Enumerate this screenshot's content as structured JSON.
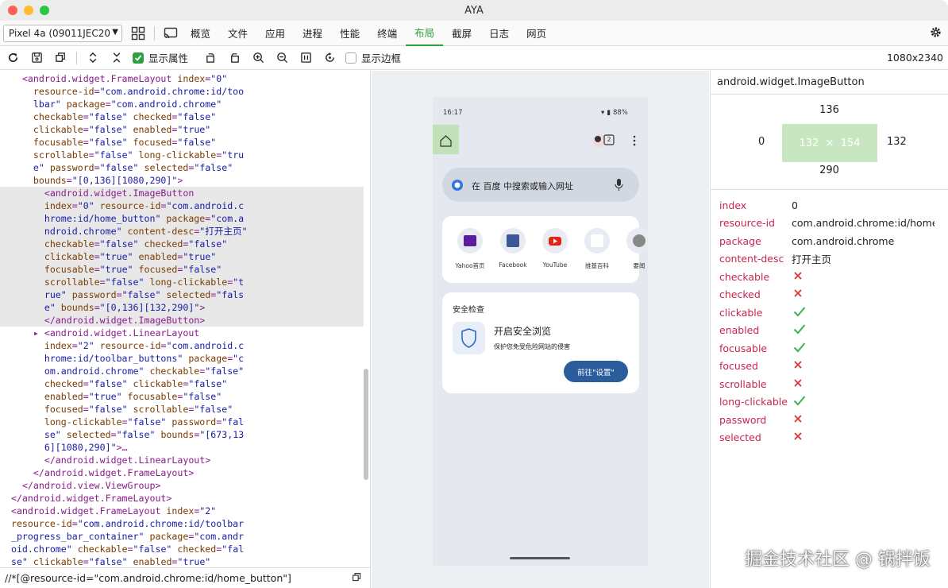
{
  "window": {
    "title": "AYA"
  },
  "toolbar": {
    "device": "Pixel 4a (09011JEC204",
    "tabs": [
      "概览",
      "文件",
      "应用",
      "进程",
      "性能",
      "终端",
      "布局",
      "截屏",
      "日志",
      "网页"
    ],
    "active_tab": "布局"
  },
  "toolbar2": {
    "show_attrs_label": "显示属性",
    "show_border_label": "显示边框",
    "resolution": "1080x2340"
  },
  "xml_tree": [
    [
      [
        "tag",
        "    <android.widget.FrameLayout "
      ],
      [
        "attr",
        "index"
      ],
      [
        "tag",
        "="
      ],
      [
        "val",
        "\"0\""
      ]
    ],
    [
      [
        "attr",
        "      resource-id"
      ],
      [
        "tag",
        "="
      ],
      [
        "val",
        "\"com.android.chrome:id/too"
      ]
    ],
    [
      [
        "val",
        "      lbar\""
      ],
      [
        "attr",
        " package"
      ],
      [
        "tag",
        "="
      ],
      [
        "val",
        "\"com.android.chrome\""
      ]
    ],
    [
      [
        "attr",
        "      checkable"
      ],
      [
        "tag",
        "="
      ],
      [
        "val",
        "\"false\""
      ],
      [
        "attr",
        " checked"
      ],
      [
        "tag",
        "="
      ],
      [
        "val",
        "\"false\""
      ]
    ],
    [
      [
        "attr",
        "      clickable"
      ],
      [
        "tag",
        "="
      ],
      [
        "val",
        "\"false\""
      ],
      [
        "attr",
        " enabled"
      ],
      [
        "tag",
        "="
      ],
      [
        "val",
        "\"true\""
      ]
    ],
    [
      [
        "attr",
        "      focusable"
      ],
      [
        "tag",
        "="
      ],
      [
        "val",
        "\"false\""
      ],
      [
        "attr",
        " focused"
      ],
      [
        "tag",
        "="
      ],
      [
        "val",
        "\"false\""
      ]
    ],
    [
      [
        "attr",
        "      scrollable"
      ],
      [
        "tag",
        "="
      ],
      [
        "val",
        "\"false\""
      ],
      [
        "attr",
        " long-clickable"
      ],
      [
        "tag",
        "="
      ],
      [
        "val",
        "\"tru"
      ]
    ],
    [
      [
        "val",
        "      e\""
      ],
      [
        "attr",
        " password"
      ],
      [
        "tag",
        "="
      ],
      [
        "val",
        "\"false\""
      ],
      [
        "attr",
        " selected"
      ],
      [
        "tag",
        "="
      ],
      [
        "val",
        "\"false\""
      ]
    ],
    [
      [
        "attr",
        "      bounds"
      ],
      [
        "tag",
        "="
      ],
      [
        "val",
        "\"[0,136][1080,290]\""
      ],
      [
        "tag",
        ">"
      ]
    ],
    [
      [
        "tag",
        "        <android.widget.ImageButton"
      ]
    ],
    [
      [
        "attr",
        "        index"
      ],
      [
        "tag",
        "="
      ],
      [
        "val",
        "\"0\""
      ],
      [
        "attr",
        " resource-id"
      ],
      [
        "tag",
        "="
      ],
      [
        "val",
        "\"com.android.c"
      ]
    ],
    [
      [
        "val",
        "        hrome:id/home_button\""
      ],
      [
        "attr",
        " package"
      ],
      [
        "tag",
        "="
      ],
      [
        "val",
        "\"com.a"
      ]
    ],
    [
      [
        "val",
        "        ndroid.chrome\""
      ],
      [
        "attr",
        " content-desc"
      ],
      [
        "tag",
        "="
      ],
      [
        "val",
        "\"打开主页\""
      ]
    ],
    [
      [
        "attr",
        "        checkable"
      ],
      [
        "tag",
        "="
      ],
      [
        "val",
        "\"false\""
      ],
      [
        "attr",
        " checked"
      ],
      [
        "tag",
        "="
      ],
      [
        "val",
        "\"false\""
      ]
    ],
    [
      [
        "attr",
        "        clickable"
      ],
      [
        "tag",
        "="
      ],
      [
        "val",
        "\"true\""
      ],
      [
        "attr",
        " enabled"
      ],
      [
        "tag",
        "="
      ],
      [
        "val",
        "\"true\""
      ]
    ],
    [
      [
        "attr",
        "        focusable"
      ],
      [
        "tag",
        "="
      ],
      [
        "val",
        "\"true\""
      ],
      [
        "attr",
        " focused"
      ],
      [
        "tag",
        "="
      ],
      [
        "val",
        "\"false\""
      ]
    ],
    [
      [
        "attr",
        "        scrollable"
      ],
      [
        "tag",
        "="
      ],
      [
        "val",
        "\"false\""
      ],
      [
        "attr",
        " long-clickable"
      ],
      [
        "tag",
        "="
      ],
      [
        "val",
        "\"t"
      ]
    ],
    [
      [
        "val",
        "        rue\""
      ],
      [
        "attr",
        " password"
      ],
      [
        "tag",
        "="
      ],
      [
        "val",
        "\"false\""
      ],
      [
        "attr",
        " selected"
      ],
      [
        "tag",
        "="
      ],
      [
        "val",
        "\"fals"
      ]
    ],
    [
      [
        "val",
        "        e\""
      ],
      [
        "attr",
        " bounds"
      ],
      [
        "tag",
        "="
      ],
      [
        "val",
        "\"[0,136][132,290]\""
      ],
      [
        "tag",
        ">"
      ]
    ],
    [
      [
        "tag",
        "        </android.widget.ImageButton>"
      ]
    ],
    [
      [
        "tag",
        "      ▸ <android.widget.LinearLayout"
      ]
    ],
    [
      [
        "attr",
        "        index"
      ],
      [
        "tag",
        "="
      ],
      [
        "val",
        "\"2\""
      ],
      [
        "attr",
        " resource-id"
      ],
      [
        "tag",
        "="
      ],
      [
        "val",
        "\"com.android.c"
      ]
    ],
    [
      [
        "val",
        "        hrome:id/toolbar_buttons\""
      ],
      [
        "attr",
        " package"
      ],
      [
        "tag",
        "="
      ],
      [
        "val",
        "\"c"
      ]
    ],
    [
      [
        "val",
        "        om.android.chrome\""
      ],
      [
        "attr",
        " checkable"
      ],
      [
        "tag",
        "="
      ],
      [
        "val",
        "\"false\""
      ]
    ],
    [
      [
        "attr",
        "        checked"
      ],
      [
        "tag",
        "="
      ],
      [
        "val",
        "\"false\""
      ],
      [
        "attr",
        " clickable"
      ],
      [
        "tag",
        "="
      ],
      [
        "val",
        "\"false\""
      ]
    ],
    [
      [
        "attr",
        "        enabled"
      ],
      [
        "tag",
        "="
      ],
      [
        "val",
        "\"true\""
      ],
      [
        "attr",
        " focusable"
      ],
      [
        "tag",
        "="
      ],
      [
        "val",
        "\"false\""
      ]
    ],
    [
      [
        "attr",
        "        focused"
      ],
      [
        "tag",
        "="
      ],
      [
        "val",
        "\"false\""
      ],
      [
        "attr",
        " scrollable"
      ],
      [
        "tag",
        "="
      ],
      [
        "val",
        "\"false\""
      ]
    ],
    [
      [
        "attr",
        "        long-clickable"
      ],
      [
        "tag",
        "="
      ],
      [
        "val",
        "\"false\""
      ],
      [
        "attr",
        " password"
      ],
      [
        "tag",
        "="
      ],
      [
        "val",
        "\"fal"
      ]
    ],
    [
      [
        "val",
        "        se\""
      ],
      [
        "attr",
        " selected"
      ],
      [
        "tag",
        "="
      ],
      [
        "val",
        "\"false\""
      ],
      [
        "attr",
        " bounds"
      ],
      [
        "tag",
        "="
      ],
      [
        "val",
        "\"[673,13"
      ]
    ],
    [
      [
        "val",
        "        6][1080,290]\""
      ],
      [
        "tag",
        ">…"
      ]
    ],
    [
      [
        "tag",
        "        </android.widget.LinearLayout>"
      ]
    ],
    [
      [
        "tag",
        "      </android.widget.FrameLayout>"
      ]
    ],
    [
      [
        "tag",
        "    </android.view.ViewGroup>"
      ]
    ],
    [
      [
        "tag",
        "  </android.widget.FrameLayout>"
      ]
    ],
    [
      [
        "tag",
        "  <android.widget.FrameLayout "
      ],
      [
        "attr",
        "index"
      ],
      [
        "tag",
        "="
      ],
      [
        "val",
        "\"2\""
      ]
    ],
    [
      [
        "attr",
        "  resource-id"
      ],
      [
        "tag",
        "="
      ],
      [
        "val",
        "\"com.android.chrome:id/toolbar"
      ]
    ],
    [
      [
        "val",
        "  _progress_bar_container\""
      ],
      [
        "attr",
        " package"
      ],
      [
        "tag",
        "="
      ],
      [
        "val",
        "\"com.andr"
      ]
    ],
    [
      [
        "val",
        "  oid.chrome\""
      ],
      [
        "attr",
        " checkable"
      ],
      [
        "tag",
        "="
      ],
      [
        "val",
        "\"false\""
      ],
      [
        "attr",
        " checked"
      ],
      [
        "tag",
        "="
      ],
      [
        "val",
        "\"fal"
      ]
    ],
    [
      [
        "val",
        "  se\""
      ],
      [
        "attr",
        " clickable"
      ],
      [
        "tag",
        "="
      ],
      [
        "val",
        "\"false\""
      ],
      [
        "attr",
        " enabled"
      ],
      [
        "tag",
        "="
      ],
      [
        "val",
        "\"true\""
      ]
    ]
  ],
  "highlight_rows": [
    9,
    19
  ],
  "xpath": "//*[@resource-id=\"com.android.chrome:id/home_button\"]",
  "phone": {
    "time": "16:17",
    "battery": "88%",
    "tab_count": "2",
    "search_placeholder": "在 百度 中搜索或输入网址",
    "shortcuts": [
      "Yahoo首页",
      "Facebook",
      "YouTube",
      "维基百科",
      "要闻"
    ],
    "safety_title": "安全检查",
    "safety_heading": "开启安全浏览",
    "safety_desc": "保护您免受危险网站的侵害",
    "safety_button": "前往\"设置\""
  },
  "inspector": {
    "class_name": "android.widget.ImageButton",
    "box": {
      "top": "136",
      "left": "0",
      "right": "132",
      "bottom": "290",
      "size": "132  ×  154"
    },
    "props": [
      {
        "key": "index",
        "value": "0"
      },
      {
        "key": "resource-id",
        "value": "com.android.chrome:id/home..."
      },
      {
        "key": "package",
        "value": "com.android.chrome"
      },
      {
        "key": "content-desc",
        "value": "打开主页"
      },
      {
        "key": "checkable",
        "bool": false
      },
      {
        "key": "checked",
        "bool": false
      },
      {
        "key": "clickable",
        "bool": true
      },
      {
        "key": "enabled",
        "bool": true
      },
      {
        "key": "focusable",
        "bool": true
      },
      {
        "key": "focused",
        "bool": false
      },
      {
        "key": "scrollable",
        "bool": false
      },
      {
        "key": "long-clickable",
        "bool": true
      },
      {
        "key": "password",
        "bool": false
      },
      {
        "key": "selected",
        "bool": false
      }
    ]
  },
  "watermark": "掘金技术社区 @ 锅拌饭",
  "colors": {
    "accent_green": "#2e9d3e",
    "check_green": "#40b04a",
    "cross_red": "#e03131",
    "prop_key": "#c7254e",
    "box_fill": "#c8e6c0"
  }
}
